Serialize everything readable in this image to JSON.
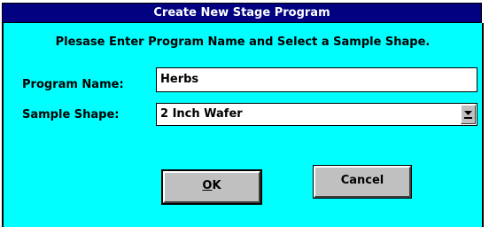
{
  "window": {
    "title": "Create New Stage Program"
  },
  "instruction": "Plesase Enter Program Name and Select a Sample Shape.",
  "program_name": {
    "label": "Program Name:",
    "value": "Herbs"
  },
  "sample_shape": {
    "label": "Sample Shape:",
    "selected": "2 Inch Wafer",
    "dropdown_icon": "chevron-down-icon"
  },
  "buttons": {
    "ok_label_accel": "O",
    "ok_label_rest": "K",
    "cancel_label": "Cancel"
  },
  "colors": {
    "title_bar": "#000080",
    "client_background": "#00ffff",
    "button_face": "#c0c0c0"
  }
}
